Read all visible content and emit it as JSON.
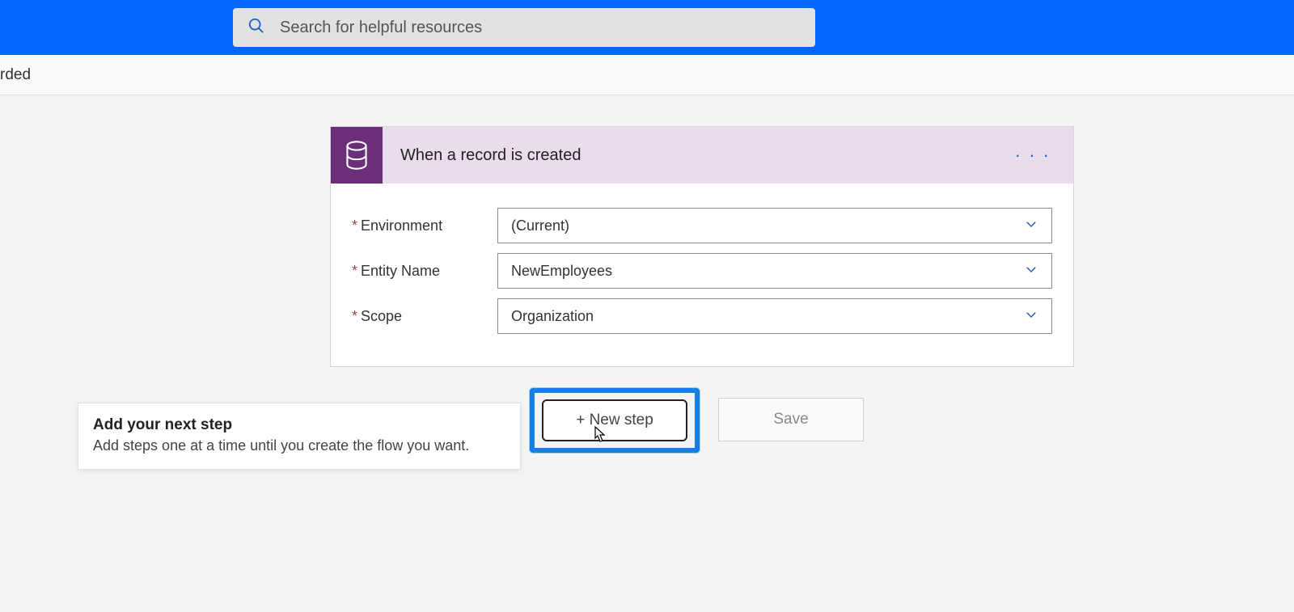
{
  "header": {
    "search_placeholder": "Search for helpful resources"
  },
  "subbar": {
    "text_fragment": "rded"
  },
  "trigger": {
    "title": "When a record is created",
    "menu_glyph": "· · ·",
    "fields": [
      {
        "label": "Environment",
        "value": "(Current)"
      },
      {
        "label": "Entity Name",
        "value": "NewEmployees"
      },
      {
        "label": "Scope",
        "value": "Organization"
      }
    ]
  },
  "tooltip": {
    "title": "Add your next step",
    "subtitle": "Add steps one at a time until you create the flow you want."
  },
  "buttons": {
    "new_step": "+ New step",
    "save": "Save"
  },
  "colors": {
    "header": "#0066ff",
    "trigger_icon": "#6b2e7a",
    "trigger_header": "#e9dceb",
    "highlight": "#157fe6"
  }
}
